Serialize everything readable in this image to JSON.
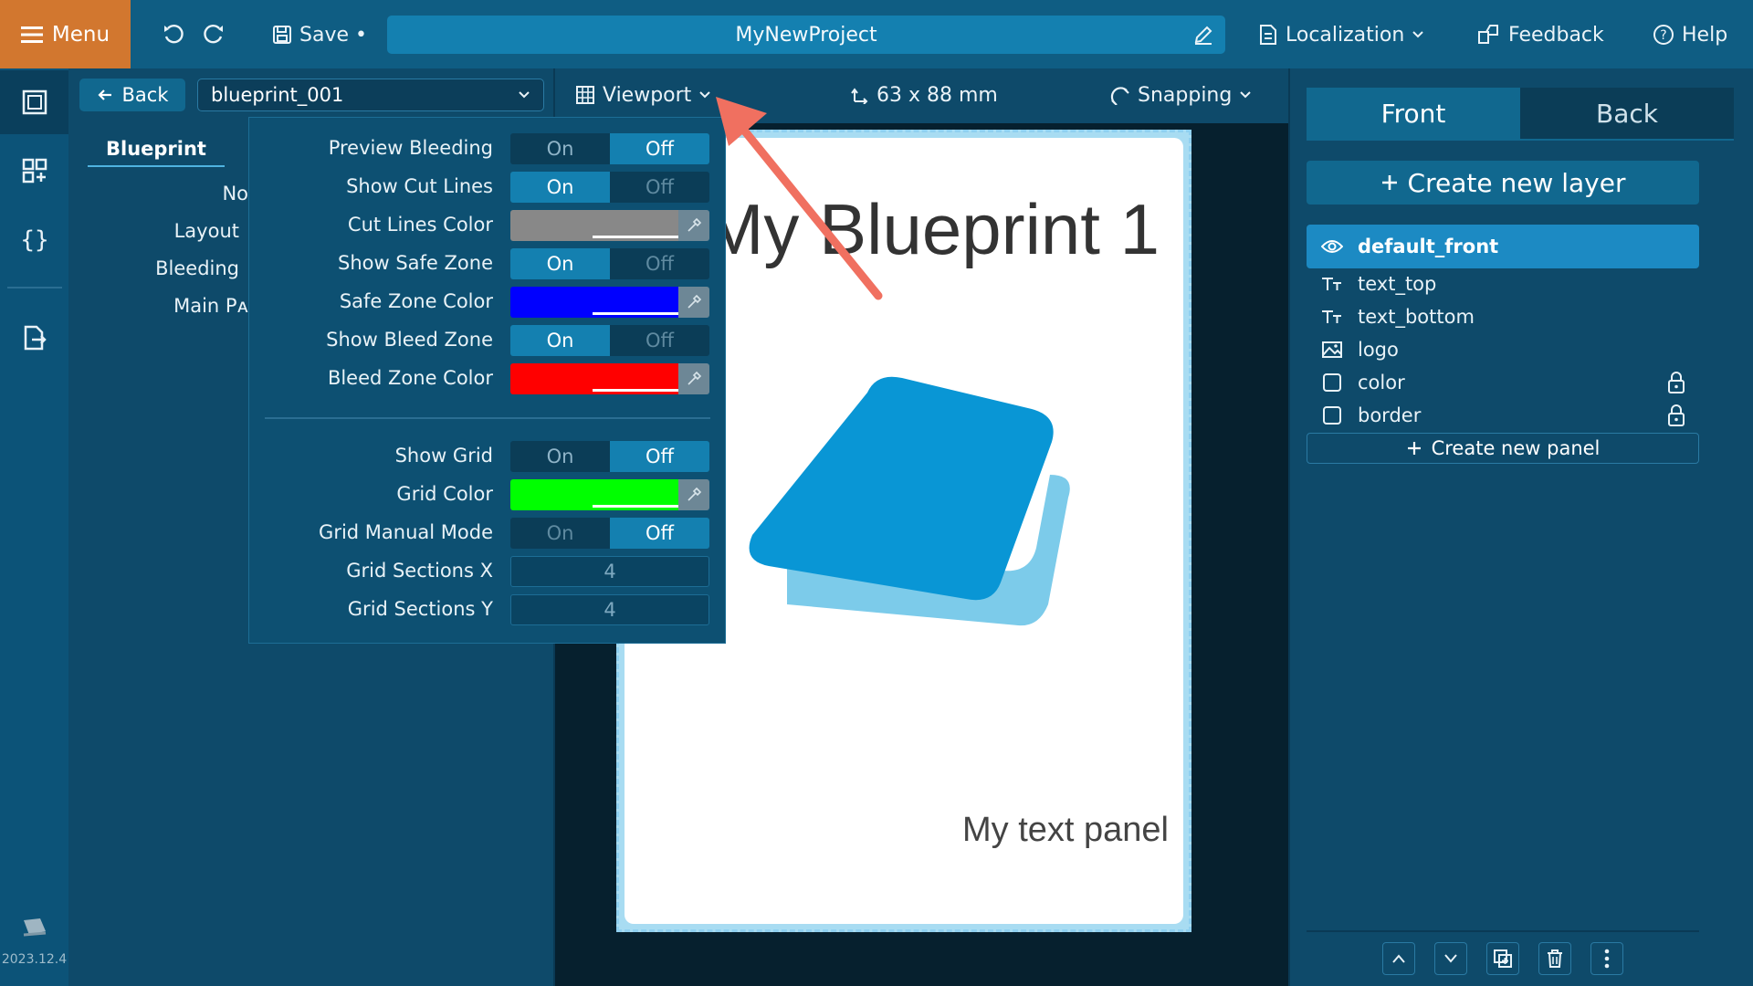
{
  "topbar": {
    "menu_label": "Menu",
    "save_label": "Save •",
    "project_name": "MyNewProject",
    "localization_label": "Localization",
    "feedback_label": "Feedback",
    "help_label": "Help"
  },
  "leftrail": {
    "version": "2023.12.4"
  },
  "leftpanel": {
    "back_label": "Back",
    "blueprint_value": "blueprint_001",
    "tab_label": "Blueprint",
    "rows": [
      "Nᴏ",
      "Layout",
      "Bleeding",
      "Main Pᴀ"
    ]
  },
  "toolbar": {
    "viewport_label": "Viewport",
    "size_label": "63 x 88 mm",
    "snapping_label": "Snapping"
  },
  "viewport_menu": {
    "on_label": "On",
    "off_label": "Off",
    "preview_bleeding": {
      "label": "Preview Bleeding",
      "value": "Off"
    },
    "show_cut_lines": {
      "label": "Show Cut Lines",
      "value": "On"
    },
    "cut_lines_color": {
      "label": "Cut Lines Color",
      "color": "#888888"
    },
    "show_safe_zone": {
      "label": "Show Safe Zone",
      "value": "On"
    },
    "safe_zone_color": {
      "label": "Safe Zone Color",
      "color": "#0000ff"
    },
    "show_bleed_zone": {
      "label": "Show Bleed Zone",
      "value": "On"
    },
    "bleed_zone_color": {
      "label": "Bleed Zone Color",
      "color": "#ff0000"
    },
    "show_grid": {
      "label": "Show Grid",
      "value": "Off"
    },
    "grid_color": {
      "label": "Grid Color",
      "color": "#00ff00"
    },
    "grid_manual_mode": {
      "label": "Grid Manual Mode",
      "value": "Off"
    },
    "grid_sections_x": {
      "label": "Grid Sections X",
      "value": "4"
    },
    "grid_sections_y": {
      "label": "Grid Sections Y",
      "value": "4"
    }
  },
  "card": {
    "title": "My Blueprint 1",
    "text_panel": "My text panel"
  },
  "rightpanel": {
    "tab_front": "Front",
    "tab_back": "Back",
    "create_layer_label": "Create new layer",
    "create_panel_label": "Create new panel",
    "layers": [
      {
        "name": "default_front",
        "icon": "eye-icon"
      },
      {
        "name": "text_top",
        "icon": "text-icon"
      },
      {
        "name": "text_bottom",
        "icon": "text-icon"
      },
      {
        "name": "logo",
        "icon": "image-icon"
      },
      {
        "name": "color",
        "icon": "square-icon",
        "locked": true
      },
      {
        "name": "border",
        "icon": "square-icon",
        "locked": true
      }
    ]
  },
  "colors": {
    "accent_orange": "#d2772f",
    "accent_blue": "#1c8ac3",
    "annotation_arrow": "#f07060"
  }
}
